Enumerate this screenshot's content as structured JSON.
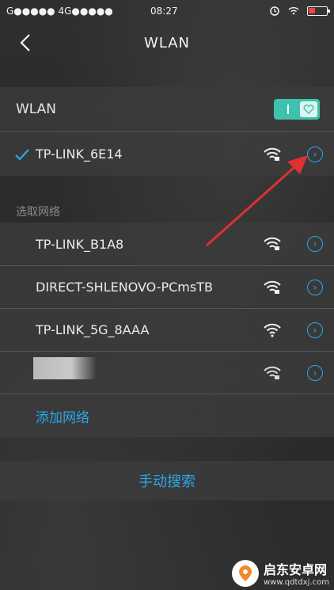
{
  "status_bar": {
    "carrier": "G●●●●● 4G●●●●●",
    "time": "08:27"
  },
  "header": {
    "title": "WLAN"
  },
  "wlan_toggle": {
    "label": "WLAN",
    "state": "on"
  },
  "connected_network": {
    "ssid": "TP-LINK_6E14",
    "secured": true
  },
  "networks_section": {
    "label": "选取网络"
  },
  "networks": [
    {
      "ssid": "TP-LINK_B1A8",
      "secured": true
    },
    {
      "ssid": "DIRECT-SHLENOVO-PCmsTB",
      "secured": true
    },
    {
      "ssid": "TP-LINK_5G_8AAA",
      "secured": false
    },
    {
      "ssid": "",
      "secured": true
    }
  ],
  "add_network": {
    "label": "添加网络"
  },
  "manual_search": {
    "label": "手动搜索"
  },
  "watermark": {
    "title": "启东安卓网",
    "url": "www.qdtdxj.com"
  },
  "colors": {
    "accent": "#2aa8e8",
    "toggle": "#3ec2ad",
    "arrow": "#e03030"
  }
}
